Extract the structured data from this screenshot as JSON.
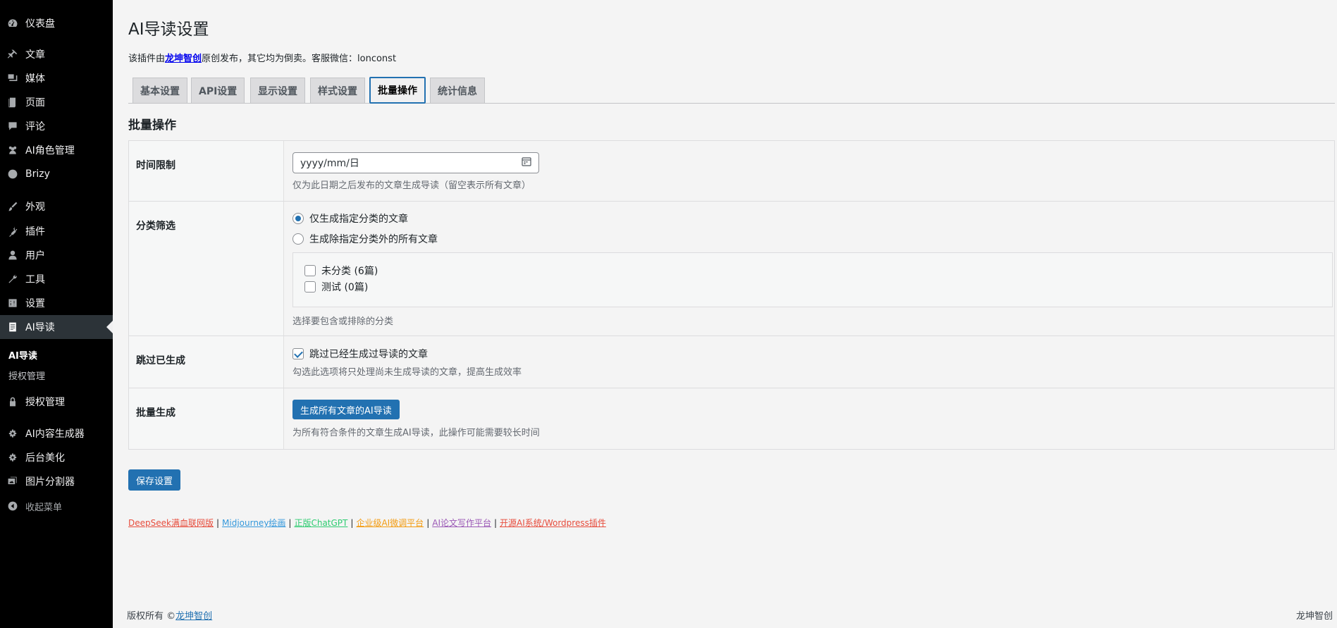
{
  "sidebar": {
    "items": [
      {
        "label": "仪表盘",
        "icon": "dashboard-icon"
      },
      {
        "label": "文章",
        "icon": "pin-icon"
      },
      {
        "label": "媒体",
        "icon": "media-icon"
      },
      {
        "label": "页面",
        "icon": "page-icon"
      },
      {
        "label": "评论",
        "icon": "comment-icon"
      },
      {
        "label": "AI角色管理",
        "icon": "users-group-icon"
      },
      {
        "label": "Brizy",
        "icon": "brizy-icon"
      },
      {
        "label": "外观",
        "icon": "paintbrush-icon"
      },
      {
        "label": "插件",
        "icon": "plugin-icon"
      },
      {
        "label": "用户",
        "icon": "user-icon"
      },
      {
        "label": "工具",
        "icon": "wrench-icon"
      },
      {
        "label": "设置",
        "icon": "settings-sliders-icon"
      },
      {
        "label": "AI导读",
        "icon": "document-icon"
      },
      {
        "label": "授权管理",
        "icon": "lock-icon"
      },
      {
        "label": "AI内容生成器",
        "icon": "gear-icon"
      },
      {
        "label": "后台美化",
        "icon": "gear-icon"
      },
      {
        "label": "图片分割器",
        "icon": "images-icon"
      },
      {
        "label": "收起菜单",
        "icon": "collapse-icon"
      }
    ],
    "submenu": [
      {
        "label": "AI导读"
      },
      {
        "label": "授权管理"
      }
    ]
  },
  "page": {
    "title": "AI导读设置",
    "notice_prefix": "该插件由",
    "notice_link": "龙坤智创",
    "notice_suffix": "原创发布，其它均为倒卖。客服微信：lonconst"
  },
  "tabs": [
    {
      "label": "基本设置"
    },
    {
      "label": "API设置"
    },
    {
      "label": "显示设置"
    },
    {
      "label": "样式设置"
    },
    {
      "label": "批量操作"
    },
    {
      "label": "统计信息"
    }
  ],
  "section": {
    "title": "批量操作"
  },
  "form": {
    "time_limit": {
      "label": "时间限制",
      "placeholder": "yyyy/mm/日",
      "desc": "仅为此日期之后发布的文章生成导读（留空表示所有文章）"
    },
    "category": {
      "label": "分类筛选",
      "option_include": "仅生成指定分类的文章",
      "option_exclude": "生成除指定分类外的所有文章",
      "categories": [
        "未分类 (6篇)",
        "测试 (0篇)"
      ],
      "desc": "选择要包含或排除的分类"
    },
    "skip": {
      "label": "跳过已生成",
      "checkbox_label": "跳过已经生成过导读的文章",
      "desc": "勾选此选项将只处理尚未生成导读的文章，提高生成效率"
    },
    "batch": {
      "label": "批量生成",
      "button": "生成所有文章的AI导读",
      "desc": "为所有符合条件的文章生成AI导读，此操作可能需要较长时间"
    }
  },
  "save_button": "保存设置",
  "links": [
    {
      "label": "DeepSeek满血联网版",
      "color": "#e74c3c"
    },
    {
      "label": "Midjourney绘画",
      "color": "#3498db"
    },
    {
      "label": "正版ChatGPT",
      "color": "#2ecc71"
    },
    {
      "label": "企业级AI微调平台",
      "color": "#f39c12"
    },
    {
      "label": "AI论文写作平台",
      "color": "#9b59b6"
    },
    {
      "label": "开源AI系统/Wordpress插件",
      "color": "#e74c3c"
    }
  ],
  "link_separator": "|",
  "footer": {
    "copyright_prefix": "版权所有 ©",
    "copyright_link": "龙坤智创",
    "right": "龙坤智创"
  },
  "colors": {
    "accent": "#2271b1",
    "sidebar_bg": "#000000"
  }
}
